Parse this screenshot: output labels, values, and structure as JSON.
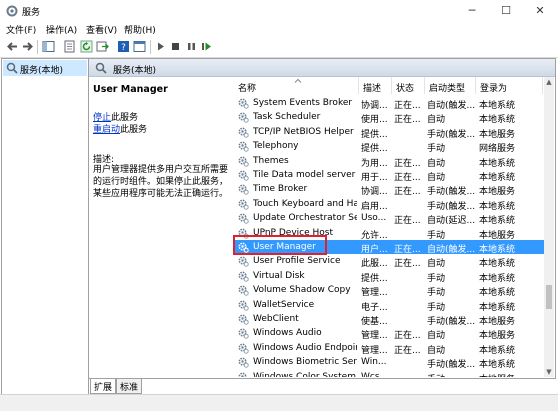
{
  "window": {
    "title": "服务",
    "controls": [
      "minimize",
      "maximize",
      "close"
    ]
  },
  "menu": [
    "文件(F)",
    "操作(A)",
    "查看(V)",
    "帮助(H)"
  ],
  "toolbar_icons": [
    "back-arrow-icon",
    "forward-arrow-icon",
    "console-tree-icon",
    "properties-icon",
    "refresh-icon",
    "export-icon",
    "help-icon",
    "console-icon",
    "play-icon",
    "stop-icon",
    "pause-icon",
    "restart-icon"
  ],
  "left_pane": {
    "tree_item": "服务(本地)"
  },
  "right_pane": {
    "header": "服务(本地)"
  },
  "description": {
    "service_name": "User Manager",
    "stop_link": "停止",
    "stop_suffix": "此服务",
    "restart_link": "重启动",
    "restart_suffix": "此服务",
    "desc_label": "描述:",
    "desc_text": "用户管理器提供多用户交互所需要的运行时组件。如果停止此服务，某些应用程序可能无法正确运行。"
  },
  "columns": [
    "名称",
    "描述",
    "状态",
    "启动类型",
    "登录为"
  ],
  "rows": [
    {
      "name": "System Events Broker",
      "desc": "协调...",
      "status": "正在...",
      "startup": "自动(触发...",
      "logon": "本地系统"
    },
    {
      "name": "Task Scheduler",
      "desc": "使用...",
      "status": "正在...",
      "startup": "自动",
      "logon": "本地系统"
    },
    {
      "name": "TCP/IP NetBIOS Helper",
      "desc": "提供...",
      "status": "",
      "startup": "手动(触发...",
      "logon": "本地服务"
    },
    {
      "name": "Telephony",
      "desc": "提供...",
      "status": "",
      "startup": "手动",
      "logon": "网络服务"
    },
    {
      "name": "Themes",
      "desc": "为用...",
      "status": "正在...",
      "startup": "自动",
      "logon": "本地系统"
    },
    {
      "name": "Tile Data model server",
      "desc": "用于...",
      "status": "正在...",
      "startup": "自动",
      "logon": "本地系统"
    },
    {
      "name": "Time Broker",
      "desc": "协调...",
      "status": "正在...",
      "startup": "手动(触发...",
      "logon": "本地服务"
    },
    {
      "name": "Touch Keyboard and Ha...",
      "desc": "启用...",
      "status": "",
      "startup": "手动(触发...",
      "logon": "本地系统"
    },
    {
      "name": "Update Orchestrator Ser...",
      "desc": "Uso...",
      "status": "正在...",
      "startup": "自动(延迟...",
      "logon": "本地系统"
    },
    {
      "name": "UPnP Device Host",
      "desc": "允许...",
      "status": "",
      "startup": "手动",
      "logon": "本地服务"
    },
    {
      "name": "User Manager",
      "desc": "用户...",
      "status": "正在...",
      "startup": "自动(触发...",
      "logon": "本地系统",
      "selected": true
    },
    {
      "name": "User Profile Service",
      "desc": "此服...",
      "status": "正在...",
      "startup": "自动",
      "logon": "本地系统"
    },
    {
      "name": "Virtual Disk",
      "desc": "提供...",
      "status": "",
      "startup": "手动",
      "logon": "本地系统"
    },
    {
      "name": "Volume Shadow Copy",
      "desc": "管理...",
      "status": "",
      "startup": "手动",
      "logon": "本地系统"
    },
    {
      "name": "WalletService",
      "desc": "电子...",
      "status": "",
      "startup": "手动",
      "logon": "本地系统"
    },
    {
      "name": "WebClient",
      "desc": "使基...",
      "status": "",
      "startup": "手动(触发...",
      "logon": "本地服务"
    },
    {
      "name": "Windows Audio",
      "desc": "管理...",
      "status": "正在...",
      "startup": "自动",
      "logon": "本地服务"
    },
    {
      "name": "Windows Audio Endpoint...",
      "desc": "管理...",
      "status": "正在...",
      "startup": "自动",
      "logon": "本地系统"
    },
    {
      "name": "Windows Biometric Servi...",
      "desc": "Win...",
      "status": "",
      "startup": "手动(触发...",
      "logon": "本地系统"
    },
    {
      "name": "Windows Color System",
      "desc": "Wcs...",
      "status": "",
      "startup": "手动",
      "logon": "本地服务"
    }
  ],
  "tabs": [
    "扩展",
    "标准"
  ],
  "colors": {
    "selection": "#3399ff",
    "highlight_box": "#e0202a",
    "link": "#0033cc",
    "header_bg": "#dbe3ee"
  }
}
